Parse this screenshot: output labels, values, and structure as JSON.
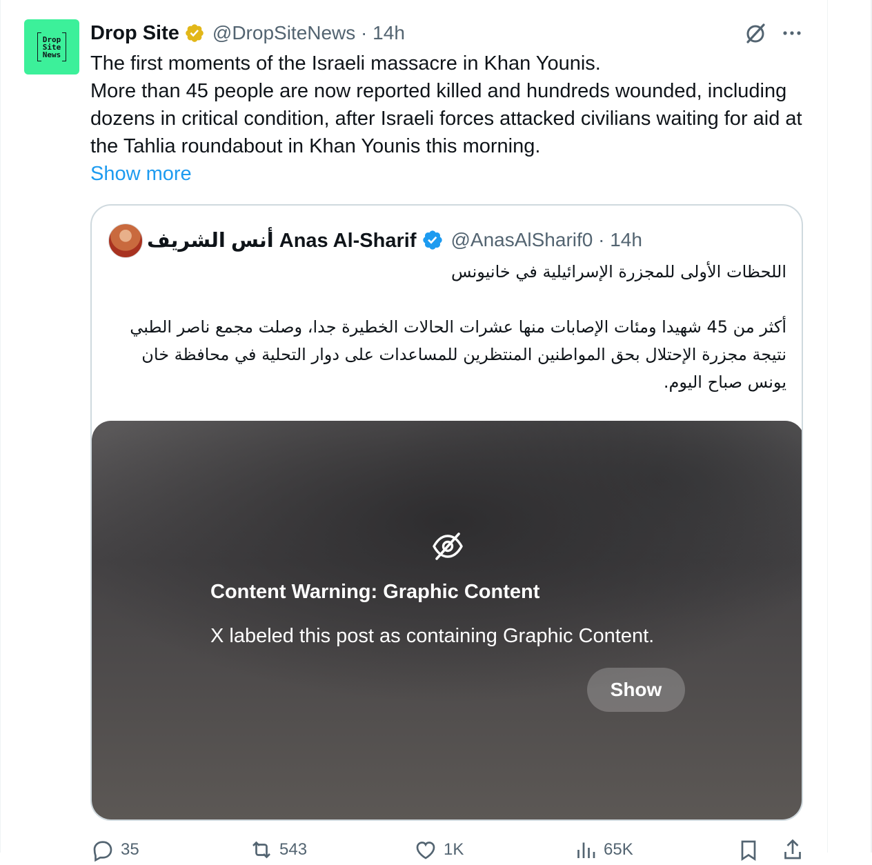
{
  "post": {
    "author_name": "Drop Site",
    "author_handle": "@DropSiteNews",
    "timestamp": "14h",
    "avatar_text": [
      "Drop",
      "Site",
      "News"
    ],
    "text_lines": [
      "The first moments of the Israeli massacre in Khan Younis.",
      "More than 45 people are now reported killed and hundreds wounded, including dozens in critical condition, after Israeli forces attacked civilians waiting for aid at the Tahlia roundabout in Khan Younis this morning."
    ],
    "show_more_label": "Show more",
    "verified_badge": "gold-check-icon"
  },
  "quote": {
    "author_name": "أنس الشريف Anas Al-Sharif",
    "author_handle": "@AnasAlSharif0",
    "timestamp": "14h",
    "verified_badge": "blue-check-icon",
    "text_para1": "اللحظات الأولى للمجزرة الإسرائيلية في خانيونس",
    "text_para2": "أكثر من 45 شهيدا ومئات الإصابات منها عشرات الحالات الخطيرة جدا، وصلت مجمع ناصر الطبي نتيجة مجزرة الإحتلال بحق المواطنين المنتظرين للمساعدات على دوار التحلية في محافظة خان يونس صباح اليوم.",
    "media": {
      "warning_title": "Content Warning: Graphic Content",
      "warning_body": "X labeled this post as containing Graphic Content.",
      "show_label": "Show",
      "icon": "eye-slash-icon"
    }
  },
  "actions": {
    "replies": "35",
    "reposts": "543",
    "likes": "1K",
    "views": "65K"
  },
  "colors": {
    "accent": "#1d9bf0",
    "gold": "#f4c543",
    "avatar_bg": "#3cf09a",
    "secondary_text": "#536471"
  }
}
